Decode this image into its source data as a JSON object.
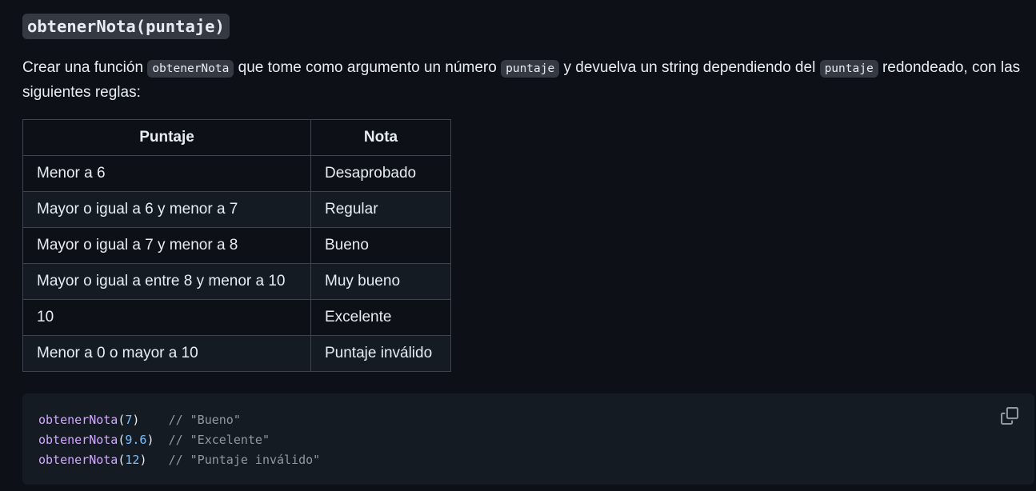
{
  "heading": "obtenerNota(puntaje)",
  "paragraph": {
    "part1": "Crear una función ",
    "code1": "obtenerNota",
    "part2": " que tome como argumento un número ",
    "code2": "puntaje",
    "part3": " y devuelva un string dependiendo del ",
    "code3": "puntaje",
    "part4": " redondeado, con las siguientes reglas:"
  },
  "table": {
    "headers": [
      "Puntaje",
      "Nota"
    ],
    "rows": [
      [
        "Menor a 6",
        "Desaprobado"
      ],
      [
        "Mayor o igual a 6 y menor a 7",
        "Regular"
      ],
      [
        "Mayor o igual a 7 y menor a 8",
        "Bueno"
      ],
      [
        "Mayor o igual a entre 8 y menor a 10",
        "Muy bueno"
      ],
      [
        "10",
        "Excelente"
      ],
      [
        "Menor a 0 o mayor a 10",
        "Puntaje inválido"
      ]
    ]
  },
  "code": {
    "lines": [
      {
        "fn": "obtenerNota",
        "open": "(",
        "arg": "7",
        "close": ")",
        "pad": "    ",
        "comment": "// \"Bueno\""
      },
      {
        "fn": "obtenerNota",
        "open": "(",
        "arg": "9.6",
        "close": ")",
        "pad": "  ",
        "comment": "// \"Excelente\""
      },
      {
        "fn": "obtenerNota",
        "open": "(",
        "arg": "12",
        "close": ")",
        "pad": "   ",
        "comment": "// \"Puntaje inválido\""
      }
    ],
    "copy_icon": "copy-icon"
  },
  "colors": {
    "background": "#0d1117",
    "code_bg": "#343942",
    "function": "#d2a8ff",
    "number": "#79c0ff",
    "comment": "#9198a1"
  }
}
